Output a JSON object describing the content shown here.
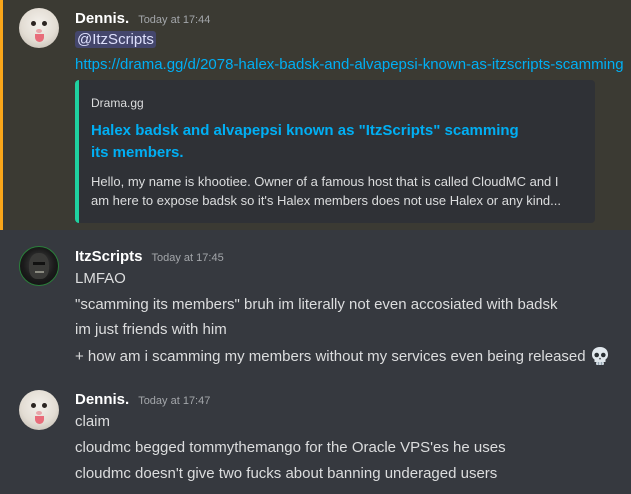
{
  "messages": [
    {
      "username": "Dennis.",
      "timestamp": "Today at 17:44",
      "mention": "@ItzScripts",
      "link": "https://drama.gg/d/2078-halex-badsk-and-alvapepsi-known-as-itzscripts-scamming",
      "embed": {
        "provider": "Drama.gg",
        "title": "Halex badsk and alvapepsi known as \"ItzScripts\" scamming its members.",
        "description": "Hello, my name is khootiee. Owner of a famous host that is called CloudMC and I am here to expose badsk so it's Halex members does not use Halex or any kind..."
      }
    },
    {
      "username": "ItzScripts",
      "timestamp": "Today at 17:45",
      "lines": [
        "LMFAO",
        "\"scamming its members\" bruh im literally not even accosiated with badsk",
        "im just friends with him",
        "+ how am i scamming my members without my services even being released"
      ],
      "emoji": "skull"
    },
    {
      "username": "Dennis.",
      "timestamp": "Today at 17:47",
      "lines": [
        "claim",
        "cloudmc begged tommythemango for the Oracle VPS'es he uses",
        "cloudmc doesn't give two fucks about banning underaged users"
      ]
    }
  ],
  "colors": {
    "background": "#36393f",
    "mention_highlight": "#faa61a",
    "link": "#00aff4",
    "embed_accent": "#1fd1a0"
  }
}
